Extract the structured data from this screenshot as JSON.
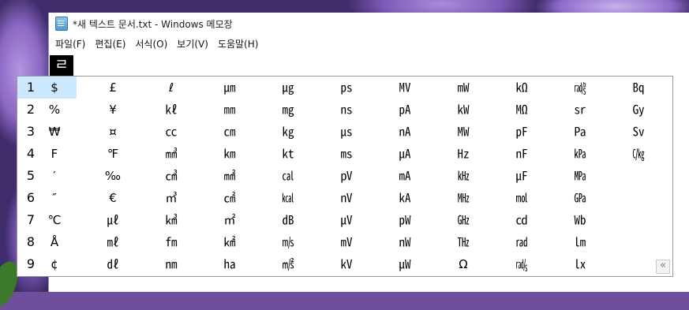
{
  "window": {
    "title": "*새 텍스트 문서.txt - Windows 메모장"
  },
  "menu": [
    "파일(F)",
    "편집(E)",
    "서식(O)",
    "보기(V)",
    "도움말(H)"
  ],
  "editor": {
    "composing_char": "ㄹ"
  },
  "candidates": {
    "selected_row": 1,
    "rows": [
      {
        "num": "1",
        "items": [
          "$",
          "£",
          "ℓ",
          "㎛",
          "㎍",
          "㎰",
          "㎹",
          "㎽",
          "㏀",
          "㎯",
          "㏃"
        ]
      },
      {
        "num": "2",
        "items": [
          "%",
          "¥",
          "㎘",
          "㎜",
          "㎎",
          "㎱",
          "㎀",
          "㎾",
          "㏁",
          "㏛",
          "㏉"
        ]
      },
      {
        "num": "3",
        "items": [
          "₩",
          "¤",
          "㏄",
          "㎝",
          "㎏",
          "㎲",
          "㎁",
          "㎿",
          "㎊",
          "㎩",
          "㏜"
        ]
      },
      {
        "num": "4",
        "items": [
          "F",
          "℉",
          "㎣",
          "㎞",
          "㏏",
          "㎳",
          "㎂",
          "㎐",
          "㎋",
          "㎪",
          "㏆"
        ]
      },
      {
        "num": "5",
        "items": [
          "′",
          "‰",
          "㎤",
          "㎟",
          "㎈",
          "㎴",
          "㎃",
          "㎑",
          "㎌",
          "㎫",
          ""
        ]
      },
      {
        "num": "6",
        "items": [
          "″",
          "€",
          "㎥",
          "㎠",
          "㎉",
          "㎵",
          "㎄",
          "㎒",
          "㏖",
          "㎬",
          ""
        ]
      },
      {
        "num": "7",
        "items": [
          "℃",
          "㎕",
          "㎦",
          "㎡",
          "㏈",
          "㎶",
          "㎺",
          "㎓",
          "㏅",
          "㏝",
          ""
        ]
      },
      {
        "num": "8",
        "items": [
          "Å",
          "㎖",
          "㎙",
          "㎢",
          "㎧",
          "㎷",
          "㎻",
          "㎔",
          "㎭",
          "㏐",
          ""
        ]
      },
      {
        "num": "9",
        "items": [
          "¢",
          "㎗",
          "㎚",
          "㏊",
          "㎨",
          "㎸",
          "㎼",
          "Ω",
          "㎮",
          "㏓",
          ""
        ]
      }
    ],
    "expand_label": "«"
  },
  "colors": {
    "selection": "#cce8ff",
    "composing_bg": "#000000"
  }
}
